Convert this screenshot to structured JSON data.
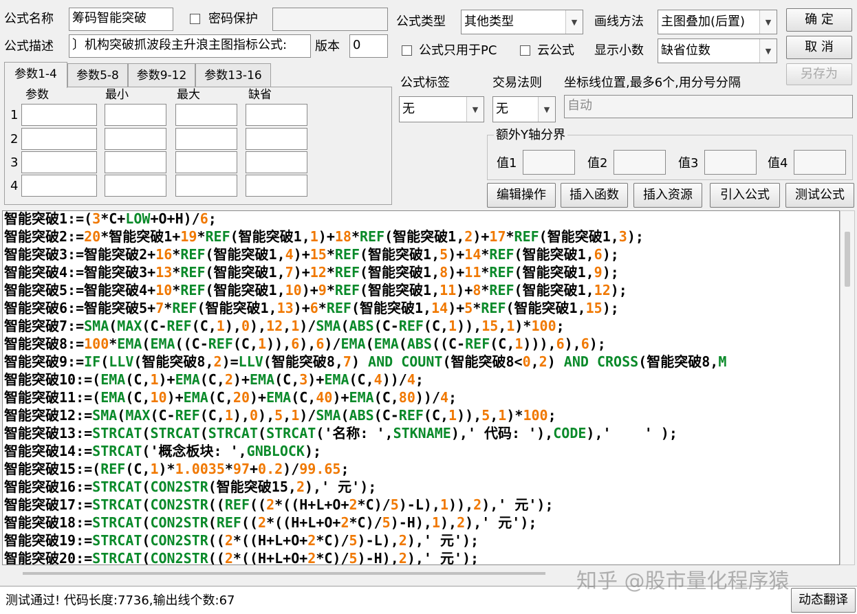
{
  "header": {
    "name_label": "公式名称",
    "name_value": "筹码智能突破",
    "password_label": "密码保护",
    "desc_label": "公式描述",
    "desc_value": "〕机构突破抓波段主升浪主图指标公式:",
    "version_label": "版本",
    "version_value": "0",
    "type_label": "公式类型",
    "type_value": "其他类型",
    "draw_label": "画线方法",
    "draw_value": "主图叠加(后置)",
    "pc_only_label": "公式只用于PC",
    "cloud_label": "云公式",
    "decimals_label": "显示小数",
    "decimals_value": "缺省位数"
  },
  "buttons": {
    "ok": "确  定",
    "cancel": "取  消",
    "save_as": "另存为",
    "edit_ops": "编辑操作",
    "insert_func": "插入函数",
    "insert_res": "插入资源",
    "import_formula": "引入公式",
    "test_formula": "测试公式",
    "dynamic_translate": "动态翻译"
  },
  "tabs": [
    "参数1-4",
    "参数5-8",
    "参数9-12",
    "参数13-16"
  ],
  "params": {
    "col_headers": [
      "参数",
      "最小",
      "最大",
      "缺省"
    ],
    "rows": [
      "1",
      "2",
      "3",
      "4"
    ]
  },
  "right_panel": {
    "tag_label": "公式标签",
    "tag_value": "无",
    "rule_label": "交易法则",
    "rule_value": "无",
    "axis_label": "坐标线位置,最多6个,用分号分隔",
    "axis_value": "自动",
    "extra_y_label": "额外Y轴分界",
    "value_labels": [
      "值1",
      "值2",
      "值3",
      "值4"
    ]
  },
  "code_lines": [
    [
      [
        "智能突破1:=(",
        "cb"
      ],
      [
        "3",
        "nm"
      ],
      [
        "*C+",
        "cb"
      ],
      [
        "LOW",
        "fn"
      ],
      [
        "+O+H)/",
        "cb"
      ],
      [
        "6",
        "nm"
      ],
      [
        ";",
        "cb"
      ]
    ],
    [
      [
        "智能突破2:=",
        "cb"
      ],
      [
        "20",
        "nm"
      ],
      [
        "*智能突破1+",
        "cb"
      ],
      [
        "19",
        "nm"
      ],
      [
        "*",
        "cb"
      ],
      [
        "REF",
        "fn"
      ],
      [
        "(智能突破1,",
        "cb"
      ],
      [
        "1",
        "nm"
      ],
      [
        ")+",
        "cb"
      ],
      [
        "18",
        "nm"
      ],
      [
        "*",
        "cb"
      ],
      [
        "REF",
        "fn"
      ],
      [
        "(智能突破1,",
        "cb"
      ],
      [
        "2",
        "nm"
      ],
      [
        ")+",
        "cb"
      ],
      [
        "17",
        "nm"
      ],
      [
        "*",
        "cb"
      ],
      [
        "REF",
        "fn"
      ],
      [
        "(智能突破1,",
        "cb"
      ],
      [
        "3",
        "nm"
      ],
      [
        ");",
        "cb"
      ]
    ],
    [
      [
        "智能突破3:=智能突破2+",
        "cb"
      ],
      [
        "16",
        "nm"
      ],
      [
        "*",
        "cb"
      ],
      [
        "REF",
        "fn"
      ],
      [
        "(智能突破1,",
        "cb"
      ],
      [
        "4",
        "nm"
      ],
      [
        ")+",
        "cb"
      ],
      [
        "15",
        "nm"
      ],
      [
        "*",
        "cb"
      ],
      [
        "REF",
        "fn"
      ],
      [
        "(智能突破1,",
        "cb"
      ],
      [
        "5",
        "nm"
      ],
      [
        ")+",
        "cb"
      ],
      [
        "14",
        "nm"
      ],
      [
        "*",
        "cb"
      ],
      [
        "REF",
        "fn"
      ],
      [
        "(智能突破1,",
        "cb"
      ],
      [
        "6",
        "nm"
      ],
      [
        ");",
        "cb"
      ]
    ],
    [
      [
        "智能突破4:=智能突破3+",
        "cb"
      ],
      [
        "13",
        "nm"
      ],
      [
        "*",
        "cb"
      ],
      [
        "REF",
        "fn"
      ],
      [
        "(智能突破1,",
        "cb"
      ],
      [
        "7",
        "nm"
      ],
      [
        ")+",
        "cb"
      ],
      [
        "12",
        "nm"
      ],
      [
        "*",
        "cb"
      ],
      [
        "REF",
        "fn"
      ],
      [
        "(智能突破1,",
        "cb"
      ],
      [
        "8",
        "nm"
      ],
      [
        ")+",
        "cb"
      ],
      [
        "11",
        "nm"
      ],
      [
        "*",
        "cb"
      ],
      [
        "REF",
        "fn"
      ],
      [
        "(智能突破1,",
        "cb"
      ],
      [
        "9",
        "nm"
      ],
      [
        ");",
        "cb"
      ]
    ],
    [
      [
        "智能突破5:=智能突破4+",
        "cb"
      ],
      [
        "10",
        "nm"
      ],
      [
        "*",
        "cb"
      ],
      [
        "REF",
        "fn"
      ],
      [
        "(智能突破1,",
        "cb"
      ],
      [
        "10",
        "nm"
      ],
      [
        ")+",
        "cb"
      ],
      [
        "9",
        "nm"
      ],
      [
        "*",
        "cb"
      ],
      [
        "REF",
        "fn"
      ],
      [
        "(智能突破1,",
        "cb"
      ],
      [
        "11",
        "nm"
      ],
      [
        ")+",
        "cb"
      ],
      [
        "8",
        "nm"
      ],
      [
        "*",
        "cb"
      ],
      [
        "REF",
        "fn"
      ],
      [
        "(智能突破1,",
        "cb"
      ],
      [
        "12",
        "nm"
      ],
      [
        ");",
        "cb"
      ]
    ],
    [
      [
        "智能突破6:=智能突破5+",
        "cb"
      ],
      [
        "7",
        "nm"
      ],
      [
        "*",
        "cb"
      ],
      [
        "REF",
        "fn"
      ],
      [
        "(智能突破1,",
        "cb"
      ],
      [
        "13",
        "nm"
      ],
      [
        ")+",
        "cb"
      ],
      [
        "6",
        "nm"
      ],
      [
        "*",
        "cb"
      ],
      [
        "REF",
        "fn"
      ],
      [
        "(智能突破1,",
        "cb"
      ],
      [
        "14",
        "nm"
      ],
      [
        ")+",
        "cb"
      ],
      [
        "5",
        "nm"
      ],
      [
        "*",
        "cb"
      ],
      [
        "REF",
        "fn"
      ],
      [
        "(智能突破1,",
        "cb"
      ],
      [
        "15",
        "nm"
      ],
      [
        ");",
        "cb"
      ]
    ],
    [
      [
        "智能突破7:=",
        "cb"
      ],
      [
        "SMA",
        "fn"
      ],
      [
        "(",
        "cb"
      ],
      [
        "MAX",
        "fn"
      ],
      [
        "(C-",
        "cb"
      ],
      [
        "REF",
        "fn"
      ],
      [
        "(C,",
        "cb"
      ],
      [
        "1",
        "nm"
      ],
      [
        "),",
        "cb"
      ],
      [
        "0",
        "nm"
      ],
      [
        "),",
        "cb"
      ],
      [
        "12",
        "nm"
      ],
      [
        ",",
        "cb"
      ],
      [
        "1",
        "nm"
      ],
      [
        ")/",
        "cb"
      ],
      [
        "SMA",
        "fn"
      ],
      [
        "(",
        "cb"
      ],
      [
        "ABS",
        "fn"
      ],
      [
        "(C-",
        "cb"
      ],
      [
        "REF",
        "fn"
      ],
      [
        "(C,",
        "cb"
      ],
      [
        "1",
        "nm"
      ],
      [
        ")),",
        "cb"
      ],
      [
        "15",
        "nm"
      ],
      [
        ",",
        "cb"
      ],
      [
        "1",
        "nm"
      ],
      [
        ")*",
        "cb"
      ],
      [
        "100",
        "nm"
      ],
      [
        ";",
        "cb"
      ]
    ],
    [
      [
        "智能突破8:=",
        "cb"
      ],
      [
        "100",
        "nm"
      ],
      [
        "*",
        "cb"
      ],
      [
        "EMA",
        "fn"
      ],
      [
        "(",
        "cb"
      ],
      [
        "EMA",
        "fn"
      ],
      [
        "((C-",
        "cb"
      ],
      [
        "REF",
        "fn"
      ],
      [
        "(C,",
        "cb"
      ],
      [
        "1",
        "nm"
      ],
      [
        ")),",
        "cb"
      ],
      [
        "6",
        "nm"
      ],
      [
        "),",
        "cb"
      ],
      [
        "6",
        "nm"
      ],
      [
        ")/",
        "cb"
      ],
      [
        "EMA",
        "fn"
      ],
      [
        "(",
        "cb"
      ],
      [
        "EMA",
        "fn"
      ],
      [
        "(",
        "cb"
      ],
      [
        "ABS",
        "fn"
      ],
      [
        "((C-",
        "cb"
      ],
      [
        "REF",
        "fn"
      ],
      [
        "(C,",
        "cb"
      ],
      [
        "1",
        "nm"
      ],
      [
        "))),",
        "cb"
      ],
      [
        "6",
        "nm"
      ],
      [
        "),",
        "cb"
      ],
      [
        "6",
        "nm"
      ],
      [
        ");",
        "cb"
      ]
    ],
    [
      [
        "智能突破9:=",
        "cb"
      ],
      [
        "IF",
        "fn"
      ],
      [
        "(",
        "cb"
      ],
      [
        "LLV",
        "fn"
      ],
      [
        "(智能突破8,",
        "cb"
      ],
      [
        "2",
        "nm"
      ],
      [
        ")=",
        "cb"
      ],
      [
        "LLV",
        "fn"
      ],
      [
        "(智能突破8,",
        "cb"
      ],
      [
        "7",
        "nm"
      ],
      [
        ") ",
        "cb"
      ],
      [
        "AND",
        "fn"
      ],
      [
        " ",
        "cb"
      ],
      [
        "COUNT",
        "fn"
      ],
      [
        "(智能突破8<",
        "cb"
      ],
      [
        "0",
        "nm"
      ],
      [
        ",",
        "cb"
      ],
      [
        "2",
        "nm"
      ],
      [
        ") ",
        "cb"
      ],
      [
        "AND",
        "fn"
      ],
      [
        " ",
        "cb"
      ],
      [
        "CROSS",
        "fn"
      ],
      [
        "(智能突破8,",
        "cb"
      ],
      [
        "M",
        "fn"
      ]
    ],
    [
      [
        "智能突破10:=(",
        "cb"
      ],
      [
        "EMA",
        "fn"
      ],
      [
        "(C,",
        "cb"
      ],
      [
        "1",
        "nm"
      ],
      [
        ")+",
        "cb"
      ],
      [
        "EMA",
        "fn"
      ],
      [
        "(C,",
        "cb"
      ],
      [
        "2",
        "nm"
      ],
      [
        ")+",
        "cb"
      ],
      [
        "EMA",
        "fn"
      ],
      [
        "(C,",
        "cb"
      ],
      [
        "3",
        "nm"
      ],
      [
        ")+",
        "cb"
      ],
      [
        "EMA",
        "fn"
      ],
      [
        "(C,",
        "cb"
      ],
      [
        "4",
        "nm"
      ],
      [
        "))/",
        "cb"
      ],
      [
        "4",
        "nm"
      ],
      [
        ";",
        "cb"
      ]
    ],
    [
      [
        "智能突破11:=(",
        "cb"
      ],
      [
        "EMA",
        "fn"
      ],
      [
        "(C,",
        "cb"
      ],
      [
        "10",
        "nm"
      ],
      [
        ")+",
        "cb"
      ],
      [
        "EMA",
        "fn"
      ],
      [
        "(C,",
        "cb"
      ],
      [
        "20",
        "nm"
      ],
      [
        ")+",
        "cb"
      ],
      [
        "EMA",
        "fn"
      ],
      [
        "(C,",
        "cb"
      ],
      [
        "40",
        "nm"
      ],
      [
        ")+",
        "cb"
      ],
      [
        "EMA",
        "fn"
      ],
      [
        "(C,",
        "cb"
      ],
      [
        "80",
        "nm"
      ],
      [
        "))/",
        "cb"
      ],
      [
        "4",
        "nm"
      ],
      [
        ";",
        "cb"
      ]
    ],
    [
      [
        "智能突破12:=",
        "cb"
      ],
      [
        "SMA",
        "fn"
      ],
      [
        "(",
        "cb"
      ],
      [
        "MAX",
        "fn"
      ],
      [
        "(C-",
        "cb"
      ],
      [
        "REF",
        "fn"
      ],
      [
        "(C,",
        "cb"
      ],
      [
        "1",
        "nm"
      ],
      [
        "),",
        "cb"
      ],
      [
        "0",
        "nm"
      ],
      [
        "),",
        "cb"
      ],
      [
        "5",
        "nm"
      ],
      [
        ",",
        "cb"
      ],
      [
        "1",
        "nm"
      ],
      [
        ")/",
        "cb"
      ],
      [
        "SMA",
        "fn"
      ],
      [
        "(",
        "cb"
      ],
      [
        "ABS",
        "fn"
      ],
      [
        "(C-",
        "cb"
      ],
      [
        "REF",
        "fn"
      ],
      [
        "(C,",
        "cb"
      ],
      [
        "1",
        "nm"
      ],
      [
        ")),",
        "cb"
      ],
      [
        "5",
        "nm"
      ],
      [
        ",",
        "cb"
      ],
      [
        "1",
        "nm"
      ],
      [
        ")*",
        "cb"
      ],
      [
        "100",
        "nm"
      ],
      [
        ";",
        "cb"
      ]
    ],
    [
      [
        "智能突破13:=",
        "cb"
      ],
      [
        "STRCAT",
        "fn"
      ],
      [
        "(",
        "cb"
      ],
      [
        "STRCAT",
        "fn"
      ],
      [
        "(",
        "cb"
      ],
      [
        "STRCAT",
        "fn"
      ],
      [
        "(",
        "cb"
      ],
      [
        "STRCAT",
        "fn"
      ],
      [
        "('名称: ',",
        "cb"
      ],
      [
        "STKNAME",
        "fn"
      ],
      [
        "),' 代码: '),",
        "cb"
      ],
      [
        "CODE",
        "fn"
      ],
      [
        "),'    ' );",
        "cb"
      ]
    ],
    [
      [
        "智能突破14:=",
        "cb"
      ],
      [
        "STRCAT",
        "fn"
      ],
      [
        "('概念板块: ',",
        "cb"
      ],
      [
        "GNBLOCK",
        "fn"
      ],
      [
        ");",
        "cb"
      ]
    ],
    [
      [
        "智能突破15:=(",
        "cb"
      ],
      [
        "REF",
        "fn"
      ],
      [
        "(C,",
        "cb"
      ],
      [
        "1",
        "nm"
      ],
      [
        ")*",
        "cb"
      ],
      [
        "1.0035",
        "nm"
      ],
      [
        "*",
        "cb"
      ],
      [
        "97",
        "nm"
      ],
      [
        "+",
        "cb"
      ],
      [
        "0.2",
        "nm"
      ],
      [
        ")/",
        "cb"
      ],
      [
        "99.65",
        "nm"
      ],
      [
        ";",
        "cb"
      ]
    ],
    [
      [
        "智能突破16:=",
        "cb"
      ],
      [
        "STRCAT",
        "fn"
      ],
      [
        "(",
        "cb"
      ],
      [
        "CON2STR",
        "fn"
      ],
      [
        "(智能突破15,",
        "cb"
      ],
      [
        "2",
        "nm"
      ],
      [
        "),' 元');",
        "cb"
      ]
    ],
    [
      [
        "智能突破17:=",
        "cb"
      ],
      [
        "STRCAT",
        "fn"
      ],
      [
        "(",
        "cb"
      ],
      [
        "CON2STR",
        "fn"
      ],
      [
        "((",
        "cb"
      ],
      [
        "REF",
        "fn"
      ],
      [
        "((",
        "cb"
      ],
      [
        "2",
        "nm"
      ],
      [
        "*((H+L+O+",
        "cb"
      ],
      [
        "2",
        "nm"
      ],
      [
        "*C)/",
        "cb"
      ],
      [
        "5",
        "nm"
      ],
      [
        ")-L),",
        "cb"
      ],
      [
        "1",
        "nm"
      ],
      [
        ")),",
        "cb"
      ],
      [
        "2",
        "nm"
      ],
      [
        "),' 元');",
        "cb"
      ]
    ],
    [
      [
        "智能突破18:=",
        "cb"
      ],
      [
        "STRCAT",
        "fn"
      ],
      [
        "(",
        "cb"
      ],
      [
        "CON2STR",
        "fn"
      ],
      [
        "(",
        "cb"
      ],
      [
        "REF",
        "fn"
      ],
      [
        "((",
        "cb"
      ],
      [
        "2",
        "nm"
      ],
      [
        "*((H+L+O+",
        "cb"
      ],
      [
        "2",
        "nm"
      ],
      [
        "*C)/",
        "cb"
      ],
      [
        "5",
        "nm"
      ],
      [
        ")-H),",
        "cb"
      ],
      [
        "1",
        "nm"
      ],
      [
        "),",
        "cb"
      ],
      [
        "2",
        "nm"
      ],
      [
        "),' 元');",
        "cb"
      ]
    ],
    [
      [
        "智能突破19:=",
        "cb"
      ],
      [
        "STRCAT",
        "fn"
      ],
      [
        "(",
        "cb"
      ],
      [
        "CON2STR",
        "fn"
      ],
      [
        "((",
        "cb"
      ],
      [
        "2",
        "nm"
      ],
      [
        "*((H+L+O+",
        "cb"
      ],
      [
        "2",
        "nm"
      ],
      [
        "*C)/",
        "cb"
      ],
      [
        "5",
        "nm"
      ],
      [
        ")-L),",
        "cb"
      ],
      [
        "2",
        "nm"
      ],
      [
        "),' 元');",
        "cb"
      ]
    ],
    [
      [
        "智能突破20:=",
        "cb"
      ],
      [
        "STRCAT",
        "fn"
      ],
      [
        "(",
        "cb"
      ],
      [
        "CON2STR",
        "fn"
      ],
      [
        "((",
        "cb"
      ],
      [
        "2",
        "nm"
      ],
      [
        "*((H+L+O+",
        "cb"
      ],
      [
        "2",
        "nm"
      ],
      [
        "*C)/",
        "cb"
      ],
      [
        "5",
        "nm"
      ],
      [
        ")-H),",
        "cb"
      ],
      [
        "2",
        "nm"
      ],
      [
        "),' 元');",
        "cb"
      ]
    ]
  ],
  "watermark": "知乎 @股市量化程序猿",
  "status_text": "测试通过! 代码长度:7736,输出线个数:67"
}
